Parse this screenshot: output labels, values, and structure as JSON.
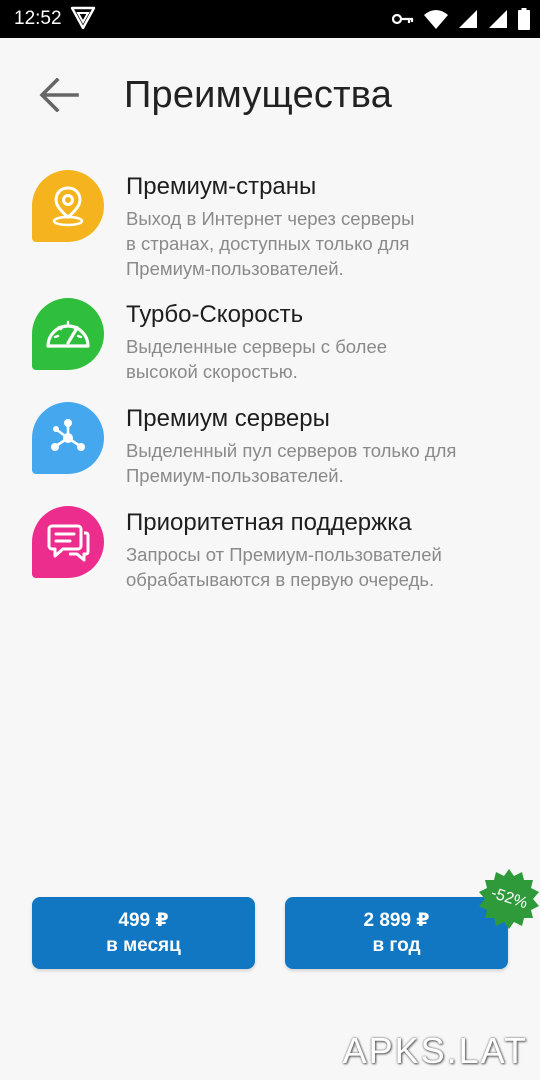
{
  "status_bar": {
    "time": "12:52",
    "icons": [
      "vpn-shield-icon",
      "key-icon",
      "wifi-icon",
      "signal-icon",
      "battery-icon"
    ]
  },
  "header": {
    "back_icon": "arrow-left-icon",
    "title": "Преимущества"
  },
  "features": [
    {
      "icon": "location-pin-icon",
      "color": "#f5b41d",
      "title": "Премиум-страны",
      "description_lines": [
        "Выход в Интернет через серверы",
        "в странах, доступных только для",
        "Премиум-пользователей."
      ]
    },
    {
      "icon": "speedometer-icon",
      "color": "#2fbf3c",
      "title": "Турбо-Скорость",
      "description_lines": [
        "Выделенные серверы с более",
        "высокой скоростью."
      ]
    },
    {
      "icon": "network-nodes-icon",
      "color": "#45a8ef",
      "title": "Премиум серверы",
      "description_lines": [
        "Выделенный пул серверов только для",
        "Премиум-пользователей."
      ]
    },
    {
      "icon": "chat-bubble-icon",
      "color": "#ec2d8e",
      "title": "Приоритетная поддержка",
      "description_lines": [
        "Запросы от Премиум-пользователей",
        "обрабатываются в первую очередь."
      ]
    }
  ],
  "plans": [
    {
      "price": "499 ₽",
      "period": "в месяц"
    },
    {
      "price": "2 899 ₽",
      "period": "в год"
    }
  ],
  "discount_badge": {
    "text": "-52%",
    "color": "#2e9a3a"
  },
  "watermark": "APKS.LAT",
  "colors": {
    "accent": "#1277c2",
    "background": "#f7f7f7"
  }
}
